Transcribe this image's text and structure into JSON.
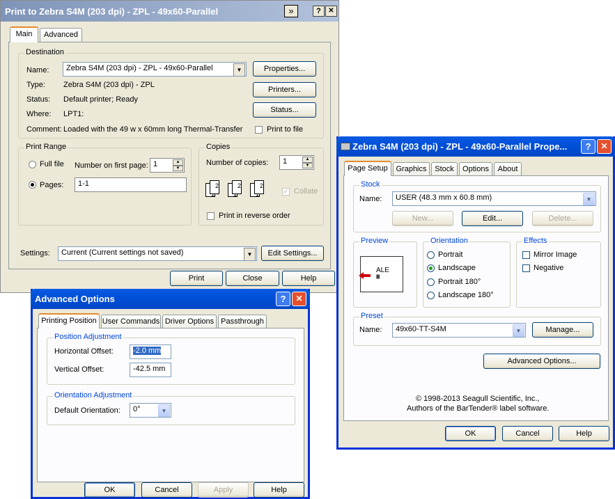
{
  "print_dialog": {
    "title": "Print to Zebra S4M (203 dpi) - ZPL - 49x60-Parallel",
    "title_icon": "double-chevron-icon",
    "help_btn": "?",
    "close_btn": "✕",
    "tabs": [
      "Main",
      "Advanced"
    ],
    "destination": {
      "group_label": "Destination",
      "name_label": "Name:",
      "name_value": "Zebra S4M (203 dpi) - ZPL - 49x60-Parallel",
      "type_label": "Type:",
      "type_value": "Zebra S4M (203 dpi) - ZPL",
      "status_label": "Status:",
      "status_value": "Default printer; Ready",
      "where_label": "Where:",
      "where_value": "LPT1:",
      "comment_label": "Comment:",
      "comment_value": "Loaded with the 49 w x 60mm long Thermal-Transfer",
      "properties_btn": "Properties...",
      "printers_btn": "Printers...",
      "status_btn": "Status...",
      "print_to_file": "Print to file"
    },
    "print_range": {
      "group_label": "Print Range",
      "full_file": "Full file",
      "number_first_page_label": "Number on first page:",
      "number_first_page_value": "1",
      "pages_label": "Pages:",
      "pages_value": "1-1"
    },
    "copies": {
      "group_label": "Copies",
      "number_label": "Number of copies:",
      "number_value": "1",
      "collate": "Collate",
      "reverse": "Print in reverse order",
      "page_digits": [
        "1",
        "2"
      ]
    },
    "settings_label": "Settings:",
    "settings_value": "Current (Current settings not saved)",
    "edit_settings_btn": "Edit Settings...",
    "print_btn": "Print",
    "close_btn_label": "Close",
    "help_btn_label": "Help"
  },
  "advanced_dialog": {
    "title": "Advanced Options",
    "help_btn": "?",
    "close_btn": "✕",
    "tabs": [
      "Printing Position",
      "User Commands",
      "Driver Options",
      "Passthrough"
    ],
    "position_group": "Position Adjustment",
    "horizontal_label": "Horizontal Offset:",
    "horizontal_value": "-2.0 mm",
    "vertical_label": "Vertical Offset:",
    "vertical_value": "-42.5 mm",
    "orientation_group": "Orientation Adjustment",
    "default_orientation_label": "Default Orientation:",
    "default_orientation_value": "0°",
    "ok_btn": "OK",
    "cancel_btn": "Cancel",
    "apply_btn": "Apply",
    "help_btn_label": "Help"
  },
  "properties_dialog": {
    "title": "Zebra S4M (203 dpi) - ZPL - 49x60-Parallel Prope...",
    "title_icon": "printer-icon",
    "help_btn": "?",
    "close_btn": "✕",
    "tabs": [
      "Page Setup",
      "Graphics",
      "Stock",
      "Options",
      "About"
    ],
    "stock": {
      "group_label": "Stock",
      "name_label": "Name:",
      "name_value": "USER (48.3 mm x 60.8 mm)",
      "new_btn": "New...",
      "edit_btn": "Edit...",
      "delete_btn": "Delete..."
    },
    "preview": {
      "group_label": "Preview",
      "label_text": "ALE",
      "barcode": "||||||||"
    },
    "orientation": {
      "group_label": "Orientation",
      "options": [
        "Portrait",
        "Landscape",
        "Portrait 180°",
        "Landscape 180°"
      ],
      "selected": "Landscape"
    },
    "effects": {
      "group_label": "Effects",
      "mirror": "Mirror Image",
      "negative": "Negative"
    },
    "preset": {
      "group_label": "Preset",
      "name_label": "Name:",
      "name_value": "49x60-TT-S4M",
      "manage_btn": "Manage..."
    },
    "advanced_options_btn": "Advanced Options...",
    "copyright_line1": "© 1998-2013 Seagull Scientific, Inc.,",
    "copyright_line2": "Authors of the BarTender® label software.",
    "ok_btn": "OK",
    "cancel_btn": "Cancel",
    "help_btn_label": "Help"
  },
  "colors": {
    "classic_titlebar_start": "#7e94b8",
    "classic_titlebar_end": "#b3c2db",
    "xp_titlebar": "#0a5ae3",
    "group_title_blue": "#0046d5",
    "face": "#ece9d8"
  }
}
